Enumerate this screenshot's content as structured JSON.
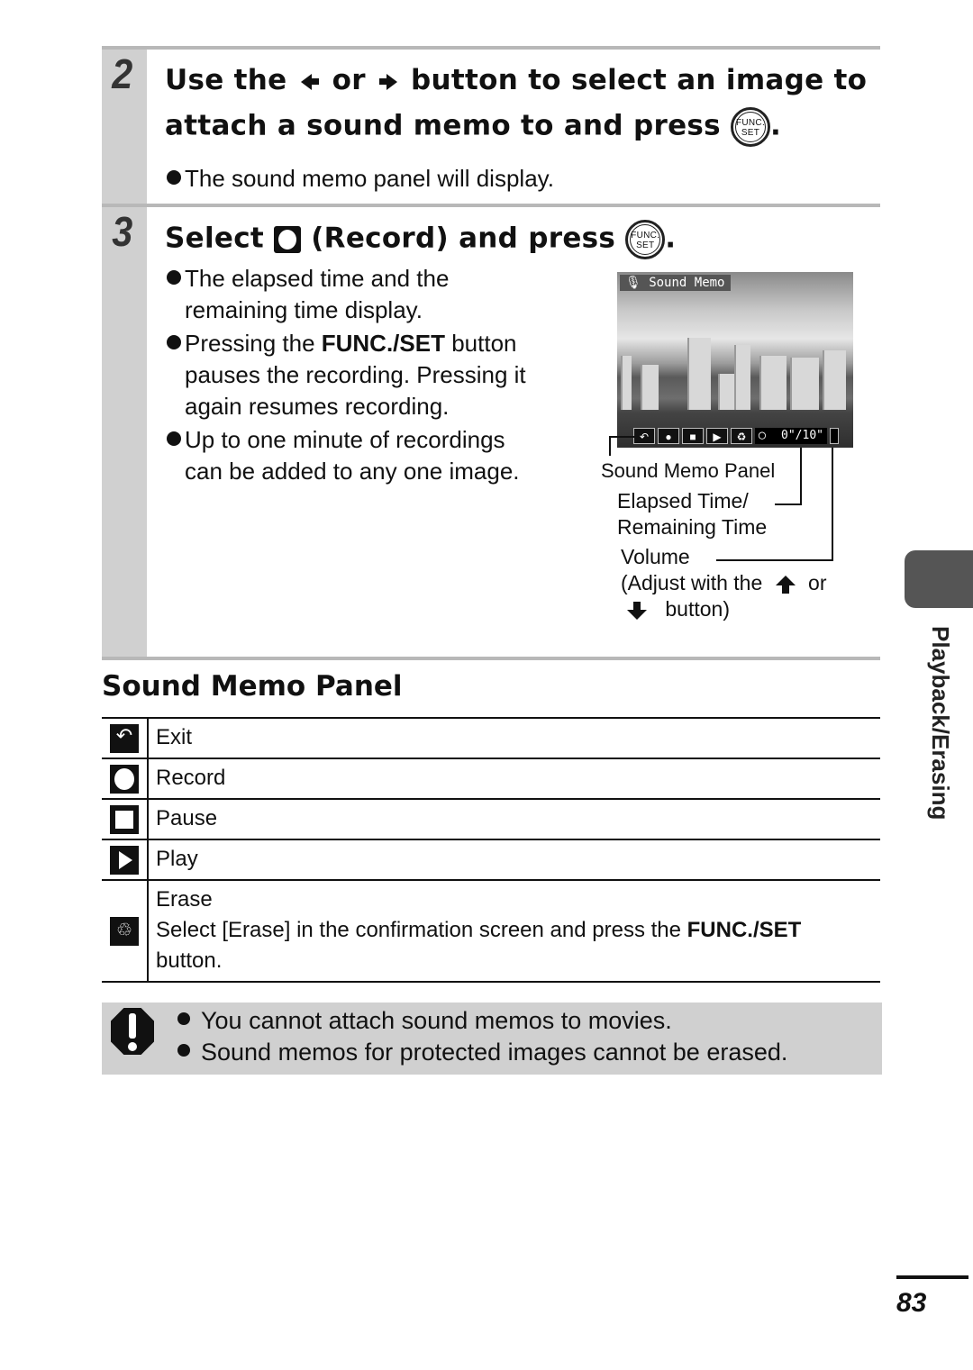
{
  "steps": [
    {
      "number": "2",
      "title_line1_a": "Use the",
      "title_line1_or": "or",
      "title_line1_b": "button to select an image to",
      "title_line2": "attach a sound memo to and press",
      "title_end": ".",
      "bullets": [
        "The sound memo panel will display."
      ]
    },
    {
      "number": "3",
      "title_a": "Select",
      "title_b": "(Record) and press",
      "title_end": ".",
      "bullets": [
        {
          "line1": "The elapsed time and the",
          "line2": "remaining time display."
        },
        {
          "pre": "Pressing the ",
          "bold": "FUNC./SET",
          "post": " button",
          "line2": "pauses the recording. Pressing it",
          "line3": "again resumes recording."
        },
        {
          "line1": "Up to one minute of recordings",
          "line2": "can be added to any one image."
        }
      ]
    }
  ],
  "func_button": {
    "top": "FUNC.",
    "bottom": "SET"
  },
  "camera_screen": {
    "title": "Sound Memo",
    "panel_buttons": [
      "exit",
      "record",
      "pause",
      "play",
      "erase"
    ],
    "time_readout": "0\"/10\""
  },
  "callouts": {
    "panel": "Sound Memo Panel",
    "elapsed_1": "Elapsed Time/",
    "elapsed_2": "Remaining Time",
    "volume": "Volume",
    "adjust_1": "(Adjust with the",
    "adjust_or": "or",
    "adjust_2": "button)"
  },
  "section": {
    "title": "Sound Memo Panel"
  },
  "table": [
    {
      "icon": "exit-icon",
      "label": "Exit"
    },
    {
      "icon": "record-icon",
      "label": "Record"
    },
    {
      "icon": "pause-icon",
      "label": "Pause"
    },
    {
      "icon": "play-icon",
      "label": "Play"
    },
    {
      "icon": "erase-icon",
      "label": "Erase",
      "desc_pre": "Select [Erase] in the confirmation screen and press the ",
      "desc_bold": "FUNC./SET",
      "desc_post": "button."
    }
  ],
  "caution": [
    "You cannot attach sound memos to movies.",
    "Sound memos for protected images cannot be erased."
  ],
  "side_tab": "Playback/Erasing",
  "page_number": "83"
}
